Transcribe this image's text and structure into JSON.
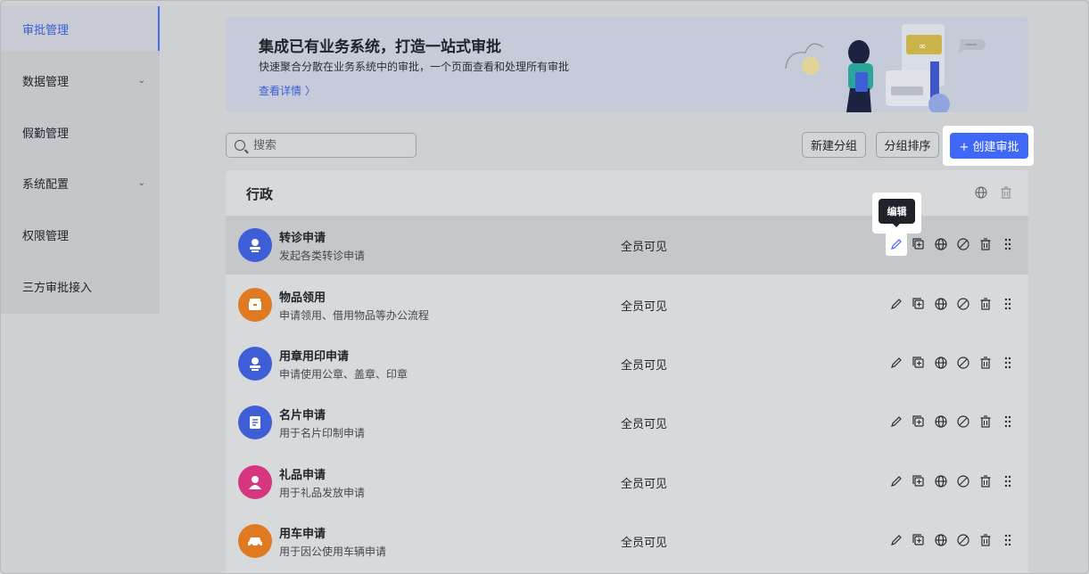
{
  "sidebar": {
    "items": [
      {
        "label": "审批管理",
        "active": true,
        "has_chevron": false
      },
      {
        "label": "数据管理",
        "active": false,
        "has_chevron": true
      },
      {
        "label": "假勤管理",
        "active": false,
        "has_chevron": false
      },
      {
        "label": "系统配置",
        "active": false,
        "has_chevron": true
      },
      {
        "label": "权限管理",
        "active": false,
        "has_chevron": false
      },
      {
        "label": "三方审批接入",
        "active": false,
        "has_chevron": false
      }
    ]
  },
  "banner": {
    "title": "集成已有业务系统，打造一站式审批",
    "subtitle": "快速聚合分散在业务系统中的审批，一个页面查看和处理所有审批",
    "link": "查看详情 〉"
  },
  "toolbar": {
    "search_placeholder": "搜索",
    "new_group": "新建分组",
    "sort_group": "分组排序",
    "create": "+ 创建审批"
  },
  "tooltip": {
    "text": "编辑"
  },
  "group": {
    "title": "行政",
    "rows": [
      {
        "name": "转诊申请",
        "desc": "发起各类转诊申请",
        "visibility": "全员可见",
        "icon": "user-badge-icon",
        "color": "#3d5ed6"
      },
      {
        "name": "物品领用",
        "desc": "申请领用、借用物品等办公流程",
        "visibility": "全员可见",
        "icon": "box-icon",
        "color": "#e07a22"
      },
      {
        "name": "用章用印申请",
        "desc": "申请使用公章、盖章、印章",
        "visibility": "全员可见",
        "icon": "stamp-icon",
        "color": "#3d5ed6"
      },
      {
        "name": "名片申请",
        "desc": "用于名片印制申请",
        "visibility": "全员可见",
        "icon": "card-icon",
        "color": "#3d5ed6"
      },
      {
        "name": "礼品申请",
        "desc": "用于礼品发放申请",
        "visibility": "全员可见",
        "icon": "person-icon",
        "color": "#d6357f"
      },
      {
        "name": "用车申请",
        "desc": "用于因公使用车辆申请",
        "visibility": "全员可见",
        "icon": "car-icon",
        "color": "#e07a22"
      }
    ]
  },
  "colors": {
    "accent": "#3f68f6",
    "sidebar_active": "#3c5bd6"
  }
}
